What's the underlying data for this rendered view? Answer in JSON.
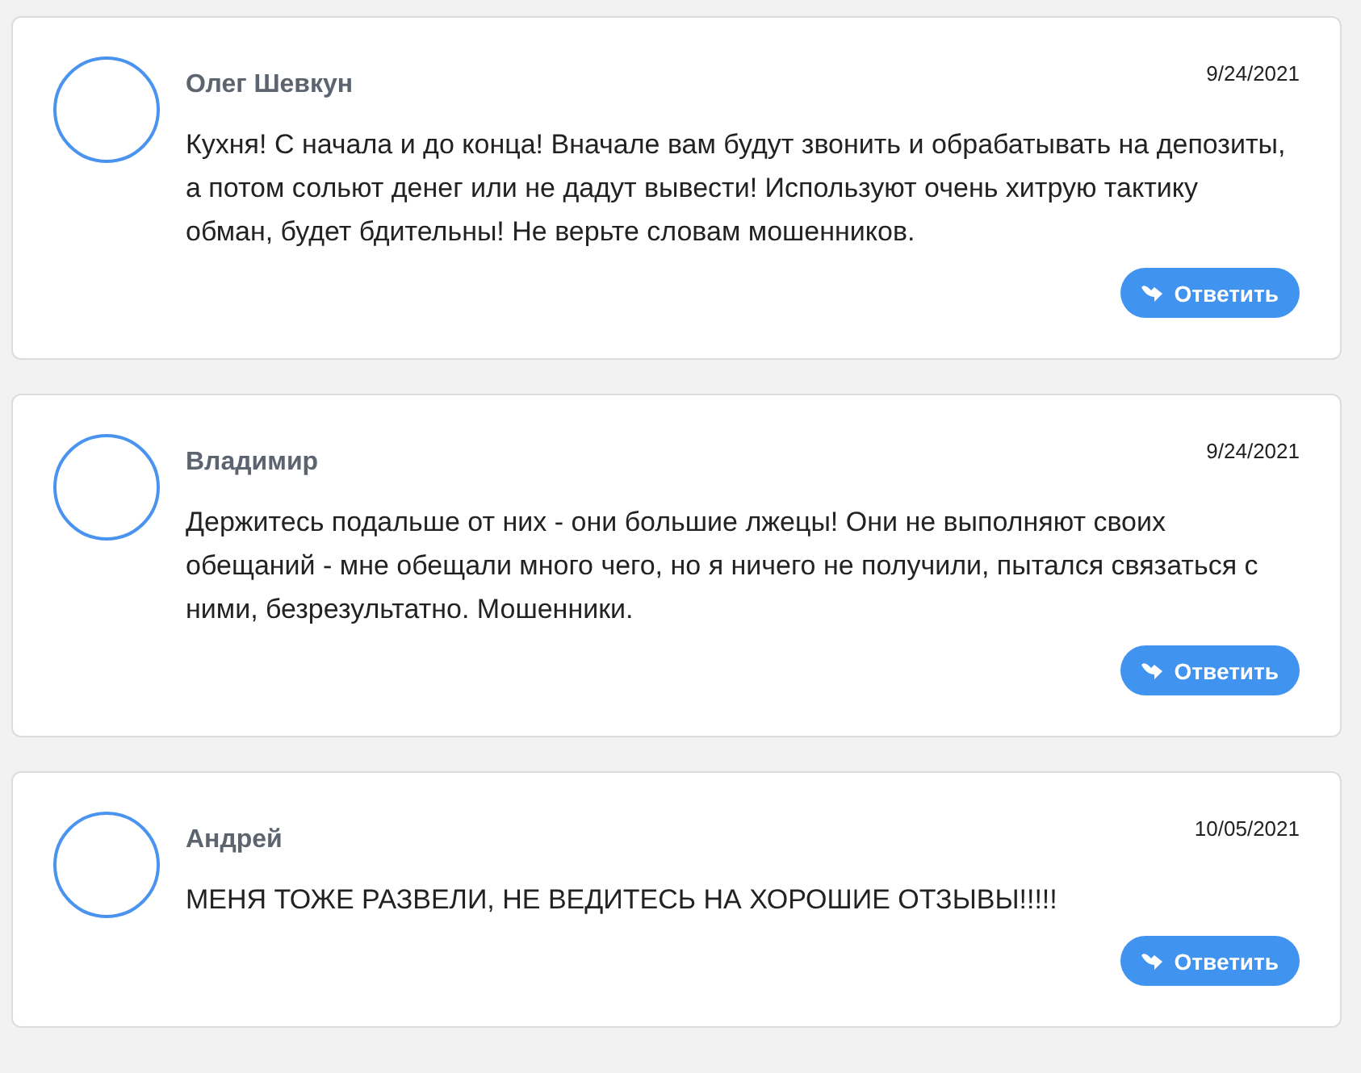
{
  "comments": [
    {
      "author": "Олег Шевкун",
      "date": "9/24/2021",
      "text": "Кухня! С начала и до конца! Вначале вам будут звонить и обрабатывать на депозиты, а потом сольют денег или не дадут вывести! Используют очень хитрую тактику обман, будет бдительны! Не верьте словам мошенников.",
      "reply": "Ответить"
    },
    {
      "author": "Владимир",
      "date": "9/24/2021",
      "text": "Держитесь подальше от них - они большие лжецы! Они не выполняют своих обещаний - мне обещали много чего, но я ничего не получили, пытался связаться с ними, безрезультатно. Мошенники.",
      "reply": "Ответить"
    },
    {
      "author": "Андрей",
      "date": "10/05/2021",
      "text": "МЕНЯ ТОЖЕ РАЗВЕЛИ, НЕ ВЕДИТЕСЬ НА ХОРОШИЕ ОТЗЫВЫ!!!!!",
      "reply": "Ответить"
    }
  ]
}
